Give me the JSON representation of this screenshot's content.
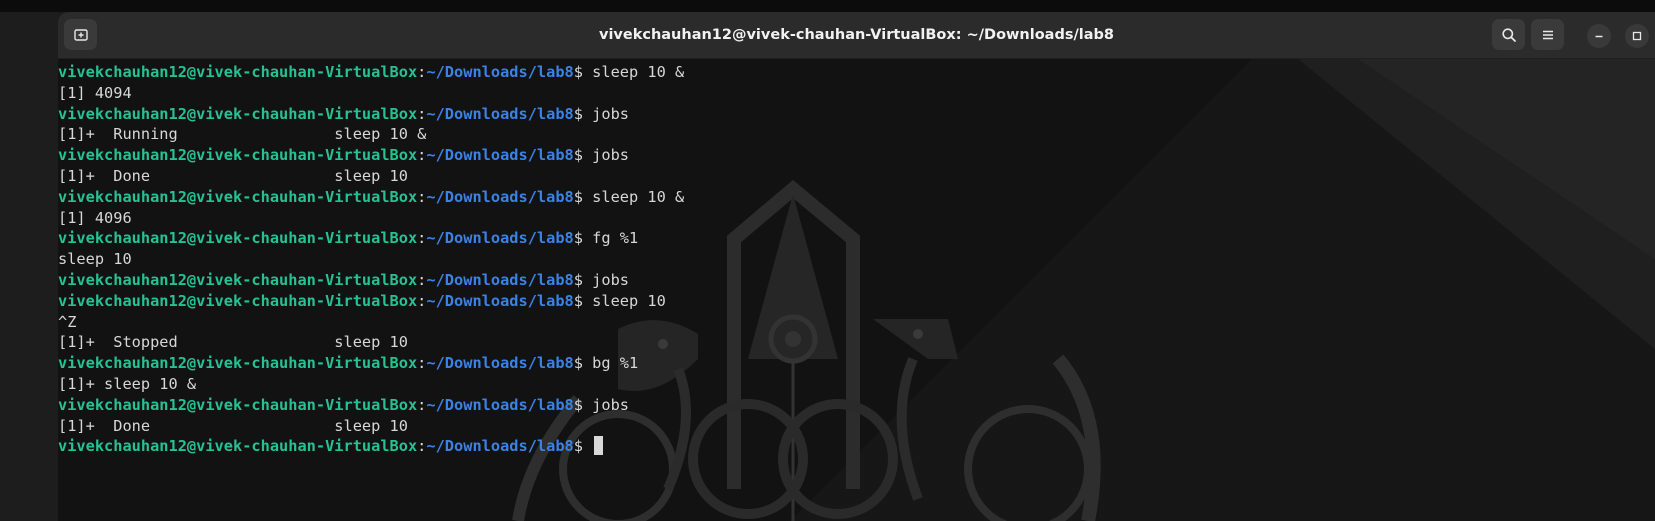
{
  "window": {
    "title": "vivekchauhan12@vivek-chauhan-VirtualBox: ~/Downloads/lab8"
  },
  "icons": {
    "new_tab": "new-tab-icon",
    "search": "search-icon",
    "menu": "hamburger-menu-icon",
    "minimize": "minimize-icon",
    "maximize": "maximize-icon"
  },
  "prompt": {
    "user_host": "vivekchauhan12@vivek-chauhan-VirtualBox",
    "separator": ":",
    "path": "~/Downloads/lab8",
    "symbol": "$ "
  },
  "lines": [
    {
      "type": "prompt",
      "command": "sleep 10 &"
    },
    {
      "type": "output",
      "text": "[1] 4094"
    },
    {
      "type": "prompt",
      "command": "jobs"
    },
    {
      "type": "output",
      "text": "[1]+  Running                 sleep 10 &"
    },
    {
      "type": "prompt",
      "command": "jobs"
    },
    {
      "type": "output",
      "text": "[1]+  Done                    sleep 10"
    },
    {
      "type": "prompt",
      "command": "sleep 10 &"
    },
    {
      "type": "output",
      "text": "[1] 4096"
    },
    {
      "type": "prompt",
      "command": "fg %1"
    },
    {
      "type": "output",
      "text": "sleep 10"
    },
    {
      "type": "prompt",
      "command": "jobs"
    },
    {
      "type": "prompt",
      "command": "sleep 10"
    },
    {
      "type": "output",
      "text": "^Z"
    },
    {
      "type": "output",
      "text": "[1]+  Stopped                 sleep 10"
    },
    {
      "type": "prompt",
      "command": "bg %1"
    },
    {
      "type": "output",
      "text": "[1]+ sleep 10 &"
    },
    {
      "type": "prompt",
      "command": "jobs"
    },
    {
      "type": "output",
      "text": "[1]+  Done                    sleep 10"
    },
    {
      "type": "prompt",
      "command": "",
      "cursor": true
    }
  ],
  "colors": {
    "user_host": "#27c291",
    "path": "#3b82e6",
    "text": "#d7d7d7",
    "background": "#121212",
    "titlebar": "#2b2b2b"
  }
}
